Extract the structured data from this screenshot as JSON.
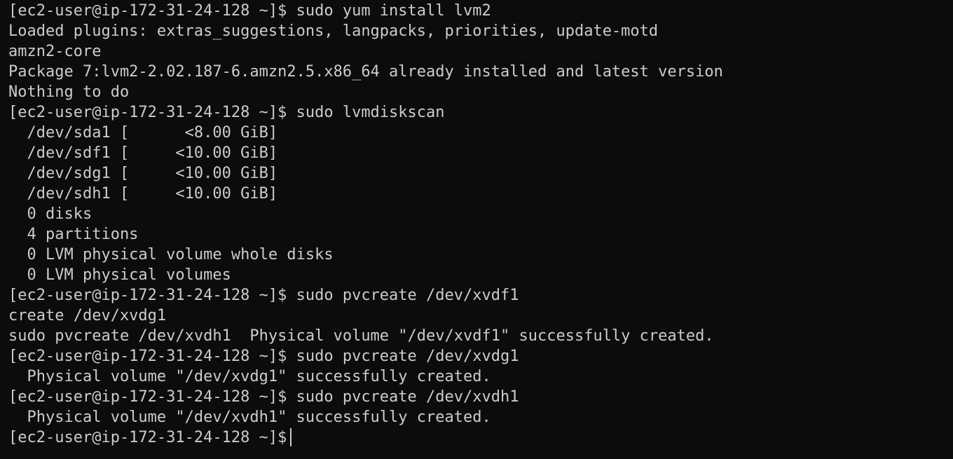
{
  "terminal": {
    "background_color": "#0c0c0c",
    "text_color": "#cccccc",
    "lines": [
      "[ec2-user@ip-172-31-24-128 ~]$ sudo yum install lvm2",
      "Loaded plugins: extras_suggestions, langpacks, priorities, update-motd",
      "amzn2-core",
      "Package 7:lvm2-2.02.187-6.amzn2.5.x86_64 already installed and latest version",
      "Nothing to do",
      "[ec2-user@ip-172-31-24-128 ~]$ sudo lvmdiskscan",
      "  /dev/sda1 [      <8.00 GiB]",
      "  /dev/sdf1 [     <10.00 GiB]",
      "  /dev/sdg1 [     <10.00 GiB]",
      "  /dev/sdh1 [     <10.00 GiB]",
      "  0 disks",
      "  4 partitions",
      "  0 LVM physical volume whole disks",
      "  0 LVM physical volumes",
      "[ec2-user@ip-172-31-24-128 ~]$ sudo pvcreate /dev/xvdf1",
      "create /dev/xvdg1",
      "sudo pvcreate /dev/xvdh1  Physical volume \"/dev/xvdf1\" successfully created.",
      "[ec2-user@ip-172-31-24-128 ~]$ sudo pvcreate /dev/xvdg1",
      "  Physical volume \"/dev/xvdg1\" successfully created.",
      "[ec2-user@ip-172-31-24-128 ~]$ sudo pvcreate /dev/xvdh1",
      "  Physical volume \"/dev/xvdh1\" successfully created.",
      "[ec2-user@ip-172-31-24-128 ~]$"
    ]
  }
}
